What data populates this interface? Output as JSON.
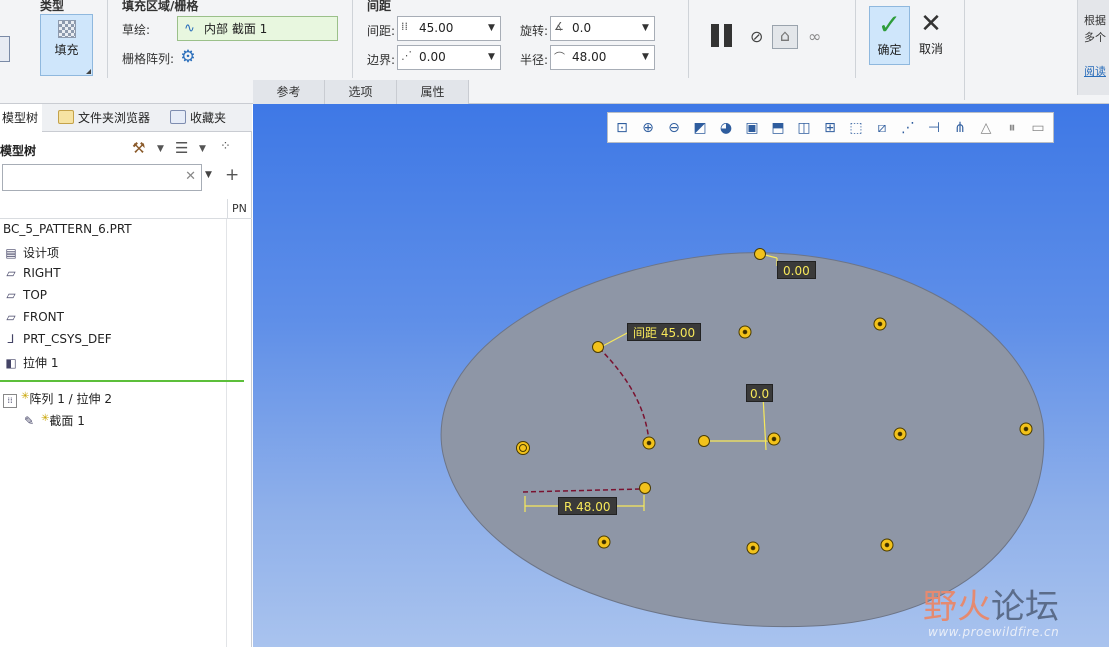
{
  "ribbon": {
    "type_group": {
      "title": "类型",
      "fill_button": "填充"
    },
    "fill_group": {
      "title": "填充区域/栅格",
      "sketch_label": "草绘:",
      "sketch_value": "内部 截面 1",
      "grid_pattern_label": "栅格阵列:"
    },
    "spacing_group": {
      "title": "间距",
      "spacing_label": "间距:",
      "spacing_value": "45.00",
      "border_label": "边界:",
      "border_value": "0.00",
      "rotation_label": "旋转:",
      "rotation_value": "0.0",
      "radius_label": "半径:",
      "radius_value": "48.00"
    },
    "actions": {
      "ok_label": "确定",
      "cancel_label": "取消"
    },
    "help_panel": {
      "line1": "根据",
      "line2": "多个",
      "link": "阅读"
    },
    "subtabs": [
      "参考",
      "选项",
      "属性"
    ]
  },
  "left_panel": {
    "tabs": [
      "模型树",
      "文件夹浏览器",
      "收藏夹"
    ],
    "tree_title": "模型树",
    "search_value": "",
    "column_header": "PN",
    "tree_items": [
      {
        "icon": "part-icon",
        "label": "BC_5_PATTERN_6.PRT"
      },
      {
        "icon": "design-items-icon",
        "label": "设计项"
      },
      {
        "icon": "datum-plane-icon",
        "label": "RIGHT"
      },
      {
        "icon": "datum-plane-icon",
        "label": "TOP"
      },
      {
        "icon": "datum-plane-icon",
        "label": "FRONT"
      },
      {
        "icon": "csys-icon",
        "label": "PRT_CSYS_DEF"
      },
      {
        "icon": "extrude-icon",
        "label": "拉伸 1"
      },
      {
        "icon": "pattern-icon",
        "label": "阵列 1 / 拉伸 2"
      },
      {
        "icon": "sketch-icon",
        "label": "截面 1"
      }
    ]
  },
  "graphics": {
    "annotations": {
      "border_value": "0.00",
      "spacing_tag": "间距 45.00",
      "rotation_value": "0.0",
      "radius_tag": "R 48.00"
    },
    "colors": {
      "part_surface": "#8e96a6",
      "dimension": "#f7e85a",
      "point": "#f2c21b"
    }
  },
  "watermark": {
    "main_a": "野火",
    "main_b": "论坛",
    "sub": "www.proewildfire.cn"
  }
}
